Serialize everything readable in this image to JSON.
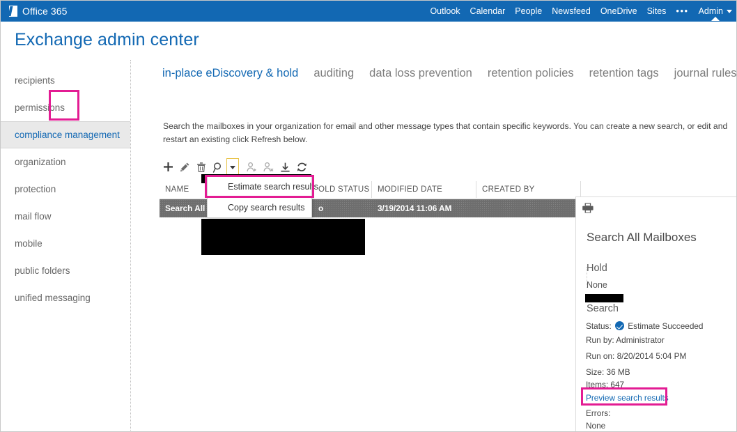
{
  "suitebar": {
    "brand": "Office 365",
    "brand_icon": "office-logo-icon",
    "links": [
      "Outlook",
      "Calendar",
      "People",
      "Newsfeed",
      "OneDrive",
      "Sites"
    ],
    "more_label": "•••",
    "admin_label": "Admin",
    "accent": "#1268b3"
  },
  "page": {
    "title": "Exchange admin center"
  },
  "sidebar": {
    "items": [
      {
        "label": "recipients",
        "selected": false
      },
      {
        "label": "permissions",
        "selected": false
      },
      {
        "label": "compliance management",
        "selected": true
      },
      {
        "label": "organization",
        "selected": false
      },
      {
        "label": "protection",
        "selected": false
      },
      {
        "label": "mail flow",
        "selected": false
      },
      {
        "label": "mobile",
        "selected": false
      },
      {
        "label": "public folders",
        "selected": false
      },
      {
        "label": "unified messaging",
        "selected": false
      }
    ]
  },
  "tabs": [
    {
      "label": "in-place eDiscovery & hold",
      "active": true
    },
    {
      "label": "auditing",
      "active": false
    },
    {
      "label": "data loss prevention",
      "active": false
    },
    {
      "label": "retention policies",
      "active": false
    },
    {
      "label": "retention tags",
      "active": false
    },
    {
      "label": "journal rules",
      "active": false
    }
  ],
  "description": "Search the mailboxes in your organization for email and other message types that contain specific keywords. You can create a new search, or edit and restart an existing click Refresh below.",
  "toolbar": {
    "buttons": [
      {
        "name": "new-icon",
        "title": "New"
      },
      {
        "name": "edit-pencil-icon",
        "title": "Edit"
      },
      {
        "name": "delete-trash-icon",
        "title": "Delete"
      },
      {
        "name": "search-magnifier-icon",
        "title": "Search"
      },
      {
        "name": "chevron-down-icon",
        "title": "More search options"
      },
      {
        "name": "hold-start-icon",
        "title": "Start hold"
      },
      {
        "name": "hold-remove-icon",
        "title": "Remove hold"
      },
      {
        "name": "export-download-icon",
        "title": "Export"
      },
      {
        "name": "refresh-icon",
        "title": "Refresh"
      }
    ]
  },
  "dropdown_menu": {
    "items": [
      "Estimate search results",
      "Copy search results"
    ],
    "highlighted_index": 0
  },
  "table": {
    "columns": [
      "NAME",
      "",
      "OLD STATUS",
      "MODIFIED DATE",
      "CREATED BY",
      ""
    ],
    "rows": [
      {
        "name": "Search All M",
        "col2": "",
        "hold_status": "o",
        "modified_date": "3/19/2014 11:06 AM",
        "created_by": "",
        "extra": ""
      }
    ]
  },
  "detail": {
    "print_icon": "printer-icon",
    "title": "Search All Mailboxes",
    "hold_heading": "Hold",
    "hold_value": "None",
    "search_heading": "Search",
    "status_label": "Status:",
    "status_value": "Estimate Succeeded",
    "status_icon": "check-circle-icon",
    "run_by": "Run by: Administrator",
    "run_on": "Run on: 8/20/2014 5:04 PM",
    "size": "Size: 36 MB",
    "items": "Items: 647",
    "preview_link": "Preview search results",
    "errors_label": "Errors:",
    "errors_value": "None"
  },
  "highlights": {
    "color": "#e31c93",
    "regions": [
      "search-split-button",
      "estimate-search-results-menu-item",
      "preview-search-results-link"
    ]
  }
}
